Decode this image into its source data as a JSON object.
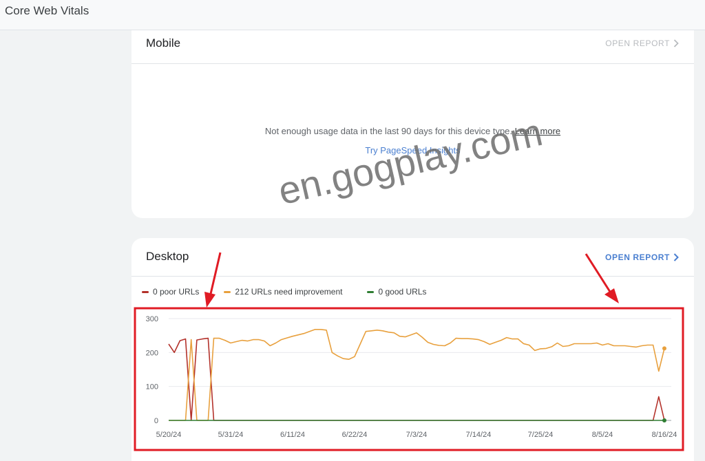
{
  "header": {
    "title": "Core Web Vitals"
  },
  "mobile": {
    "title": "Mobile",
    "open_report": "OPEN REPORT",
    "message": "Not enough usage data in the last 90 days for this device type.",
    "learn_more": "Learn more",
    "psi_link": "Try PageSpeed Insights"
  },
  "desktop": {
    "title": "Desktop",
    "open_report": "OPEN REPORT",
    "legend": [
      {
        "label": "0 poor URLs",
        "color": "#b3312a"
      },
      {
        "label": "212 URLs need improvement",
        "color": "#e8a03d"
      },
      {
        "label": "0 good URLs",
        "color": "#2e7d32"
      }
    ]
  },
  "watermark": "en.gogplay.com",
  "colors": {
    "highlight": "#e01b24",
    "accent": "#4a7fd0"
  },
  "chart_data": {
    "type": "line",
    "x_tick_labels": [
      "5/20/24",
      "5/31/24",
      "6/11/24",
      "6/22/24",
      "7/3/24",
      "7/14/24",
      "7/25/24",
      "8/5/24",
      "8/16/24"
    ],
    "x_tick_index": [
      0,
      11,
      22,
      33,
      44,
      55,
      66,
      77,
      88
    ],
    "y_ticks": [
      0,
      100,
      200,
      300
    ],
    "ylim": [
      0,
      300
    ],
    "grid": true,
    "series": [
      {
        "name": "poor",
        "color": "#b3312a",
        "values": [
          225,
          200,
          235,
          240,
          0,
          237,
          240,
          242,
          0,
          0,
          0,
          0,
          0,
          0,
          0,
          0,
          0,
          0,
          0,
          0,
          0,
          0,
          0,
          0,
          0,
          0,
          0,
          0,
          0,
          0,
          0,
          0,
          0,
          0,
          0,
          0,
          0,
          0,
          0,
          0,
          0,
          0,
          0,
          0,
          0,
          0,
          0,
          0,
          0,
          0,
          0,
          0,
          0,
          0,
          0,
          0,
          0,
          0,
          0,
          0,
          0,
          0,
          0,
          0,
          0,
          0,
          0,
          0,
          0,
          0,
          0,
          0,
          0,
          0,
          0,
          0,
          0,
          0,
          0,
          0,
          0,
          0,
          0,
          0,
          0,
          0,
          0,
          70,
          0
        ]
      },
      {
        "name": "need improvement",
        "color": "#e8a03d",
        "values": [
          0,
          0,
          0,
          0,
          238,
          0,
          0,
          0,
          242,
          242,
          236,
          228,
          232,
          236,
          234,
          238,
          238,
          234,
          220,
          228,
          238,
          243,
          248,
          252,
          256,
          262,
          268,
          268,
          266,
          200,
          190,
          182,
          180,
          188,
          225,
          262,
          264,
          266,
          264,
          260,
          258,
          248,
          246,
          252,
          258,
          245,
          230,
          224,
          221,
          220,
          228,
          242,
          241,
          241,
          240,
          238,
          232,
          224,
          230,
          236,
          244,
          240,
          240,
          226,
          222,
          206,
          211,
          212,
          217,
          228,
          218,
          220,
          226,
          226,
          226,
          226,
          228,
          222,
          226,
          220,
          220,
          220,
          218,
          216,
          220,
          222,
          222,
          145,
          212
        ],
        "end_marker": true
      },
      {
        "name": "good",
        "color": "#2e7d32",
        "values": [
          0,
          0,
          0,
          0,
          0,
          0,
          0,
          0,
          0,
          0,
          0,
          0,
          0,
          0,
          0,
          0,
          0,
          0,
          0,
          0,
          0,
          0,
          0,
          0,
          0,
          0,
          0,
          0,
          0,
          0,
          0,
          0,
          0,
          0,
          0,
          0,
          0,
          0,
          0,
          0,
          0,
          0,
          0,
          0,
          0,
          0,
          0,
          0,
          0,
          0,
          0,
          0,
          0,
          0,
          0,
          0,
          0,
          0,
          0,
          0,
          0,
          0,
          0,
          0,
          0,
          0,
          0,
          0,
          0,
          0,
          0,
          0,
          0,
          0,
          0,
          0,
          0,
          0,
          0,
          0,
          0,
          0,
          0,
          0,
          0,
          0,
          0,
          0,
          0
        ],
        "end_marker": true
      }
    ]
  }
}
